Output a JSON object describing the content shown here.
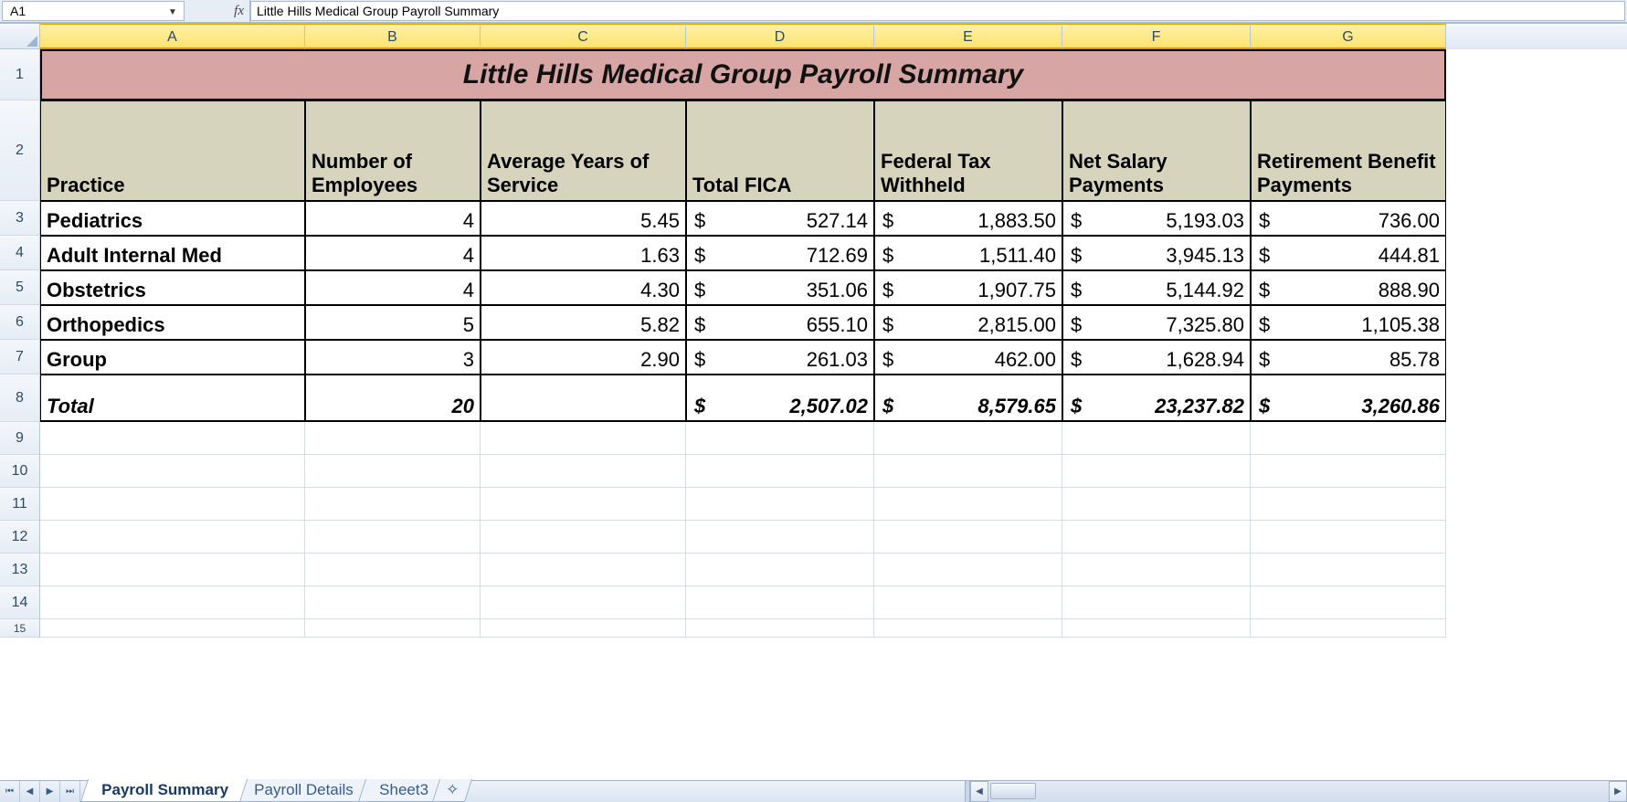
{
  "formula_bar": {
    "cell_ref": "A1",
    "fx_label": "fx",
    "content": "Little Hills Medical Group Payroll Summary"
  },
  "columns": [
    "A",
    "B",
    "C",
    "D",
    "E",
    "F",
    "G"
  ],
  "row_heights": {
    "r1": 56,
    "r2": 110,
    "r3": 38,
    "r4": 38,
    "r5": 38,
    "r6": 38,
    "r7": 38,
    "r8": 52,
    "r9": 36,
    "r10": 36,
    "r11": 36,
    "r12": 36,
    "r13": 36,
    "r14": 36,
    "r15": 20
  },
  "title": "Little Hills Medical Group Payroll Summary",
  "headers": {
    "practice": "Practice",
    "num_emp": "Number of Employees",
    "avg_years": "Average Years of Service",
    "total_fica": "Total FICA",
    "fed_tax": "Federal Tax Withheld",
    "net_salary": "Net Salary Payments",
    "retirement": "Retirement Benefit Payments"
  },
  "rows": [
    {
      "practice": "Pediatrics",
      "emp": "4",
      "years": "5.45",
      "fica": "527.14",
      "tax": "1,883.50",
      "net": "5,193.03",
      "ret": "736.00"
    },
    {
      "practice": "Adult Internal Med",
      "emp": "4",
      "years": "1.63",
      "fica": "712.69",
      "tax": "1,511.40",
      "net": "3,945.13",
      "ret": "444.81"
    },
    {
      "practice": "Obstetrics",
      "emp": "4",
      "years": "4.30",
      "fica": "351.06",
      "tax": "1,907.75",
      "net": "5,144.92",
      "ret": "888.90"
    },
    {
      "practice": "Orthopedics",
      "emp": "5",
      "years": "5.82",
      "fica": "655.10",
      "tax": "2,815.00",
      "net": "7,325.80",
      "ret": "1,105.38"
    },
    {
      "practice": "Group",
      "emp": "3",
      "years": "2.90",
      "fica": "261.03",
      "tax": "462.00",
      "net": "1,628.94",
      "ret": "85.78"
    }
  ],
  "total": {
    "label": "Total",
    "emp": "20",
    "years": "",
    "fica": "2,507.02",
    "tax": "8,579.65",
    "net": "23,237.82",
    "ret": "3,260.86"
  },
  "currency_symbol": "$",
  "tabs": {
    "nav": {
      "first": "⏮",
      "prev": "◀",
      "next": "▶",
      "last": "⏭"
    },
    "items": [
      {
        "label": "Payroll Summary",
        "active": true
      },
      {
        "label": "Payroll Details",
        "active": false
      },
      {
        "label": "Sheet3",
        "active": false
      }
    ],
    "new_icon": "✧"
  },
  "row_labels": [
    "1",
    "2",
    "3",
    "4",
    "5",
    "6",
    "7",
    "8",
    "9",
    "10",
    "11",
    "12",
    "13",
    "14",
    "15"
  ]
}
